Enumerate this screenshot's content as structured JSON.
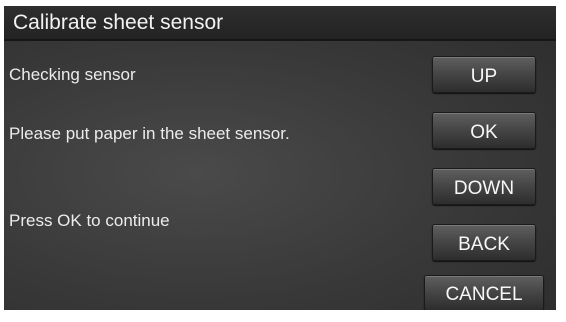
{
  "title": "Calibrate sheet sensor",
  "messages": {
    "status": "Checking sensor",
    "instruction": "Please put paper in the sheet sensor.",
    "prompt": "Press OK to continue"
  },
  "buttons": {
    "up": "UP",
    "ok": "OK",
    "down": "DOWN",
    "back": "BACK",
    "cancel": "CANCEL"
  },
  "colors": {
    "panel_background": "#3b3b3b",
    "title_bar": "#262626",
    "text": "#ececec"
  }
}
